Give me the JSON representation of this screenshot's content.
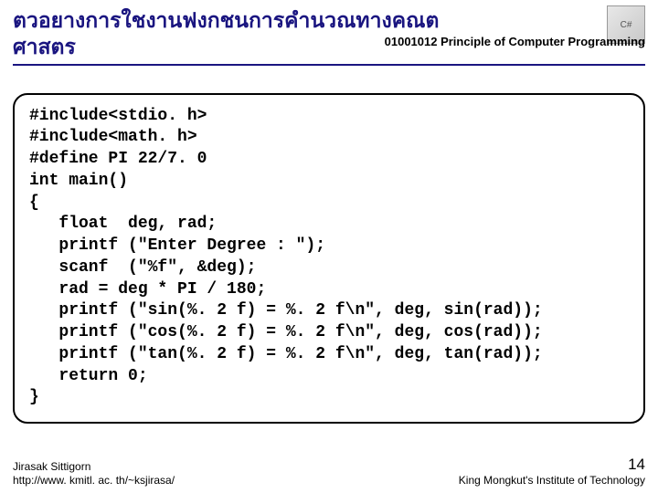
{
  "header": {
    "title_line1": "ตวอยางการใชงานฟงกชนการคำนวณทางคณต",
    "title_line2": "ศาสตร",
    "subtitle": "01001012 Principle of Computer Programming",
    "logo_text": "C#"
  },
  "code": {
    "lines": [
      "#include<stdio. h>",
      "#include<math. h>",
      "#define PI 22/7. 0",
      "int main()",
      "{",
      "   float  deg, rad;",
      "   printf (\"Enter Degree : \");",
      "   scanf  (\"%f\", &deg);",
      "   rad = deg * PI / 180;",
      "   printf (\"sin(%. 2 f) = %. 2 f\\n\", deg, sin(rad));",
      "   printf (\"cos(%. 2 f) = %. 2 f\\n\", deg, cos(rad));",
      "   printf (\"tan(%. 2 f) = %. 2 f\\n\", deg, tan(rad));",
      "   return 0;",
      "}"
    ]
  },
  "footer": {
    "author": "Jirasak Sittigorn",
    "url": "http://www. kmitl. ac. th/~ksjirasa/",
    "slide_number": "14",
    "institution": "King Mongkut's Institute of Technology"
  }
}
